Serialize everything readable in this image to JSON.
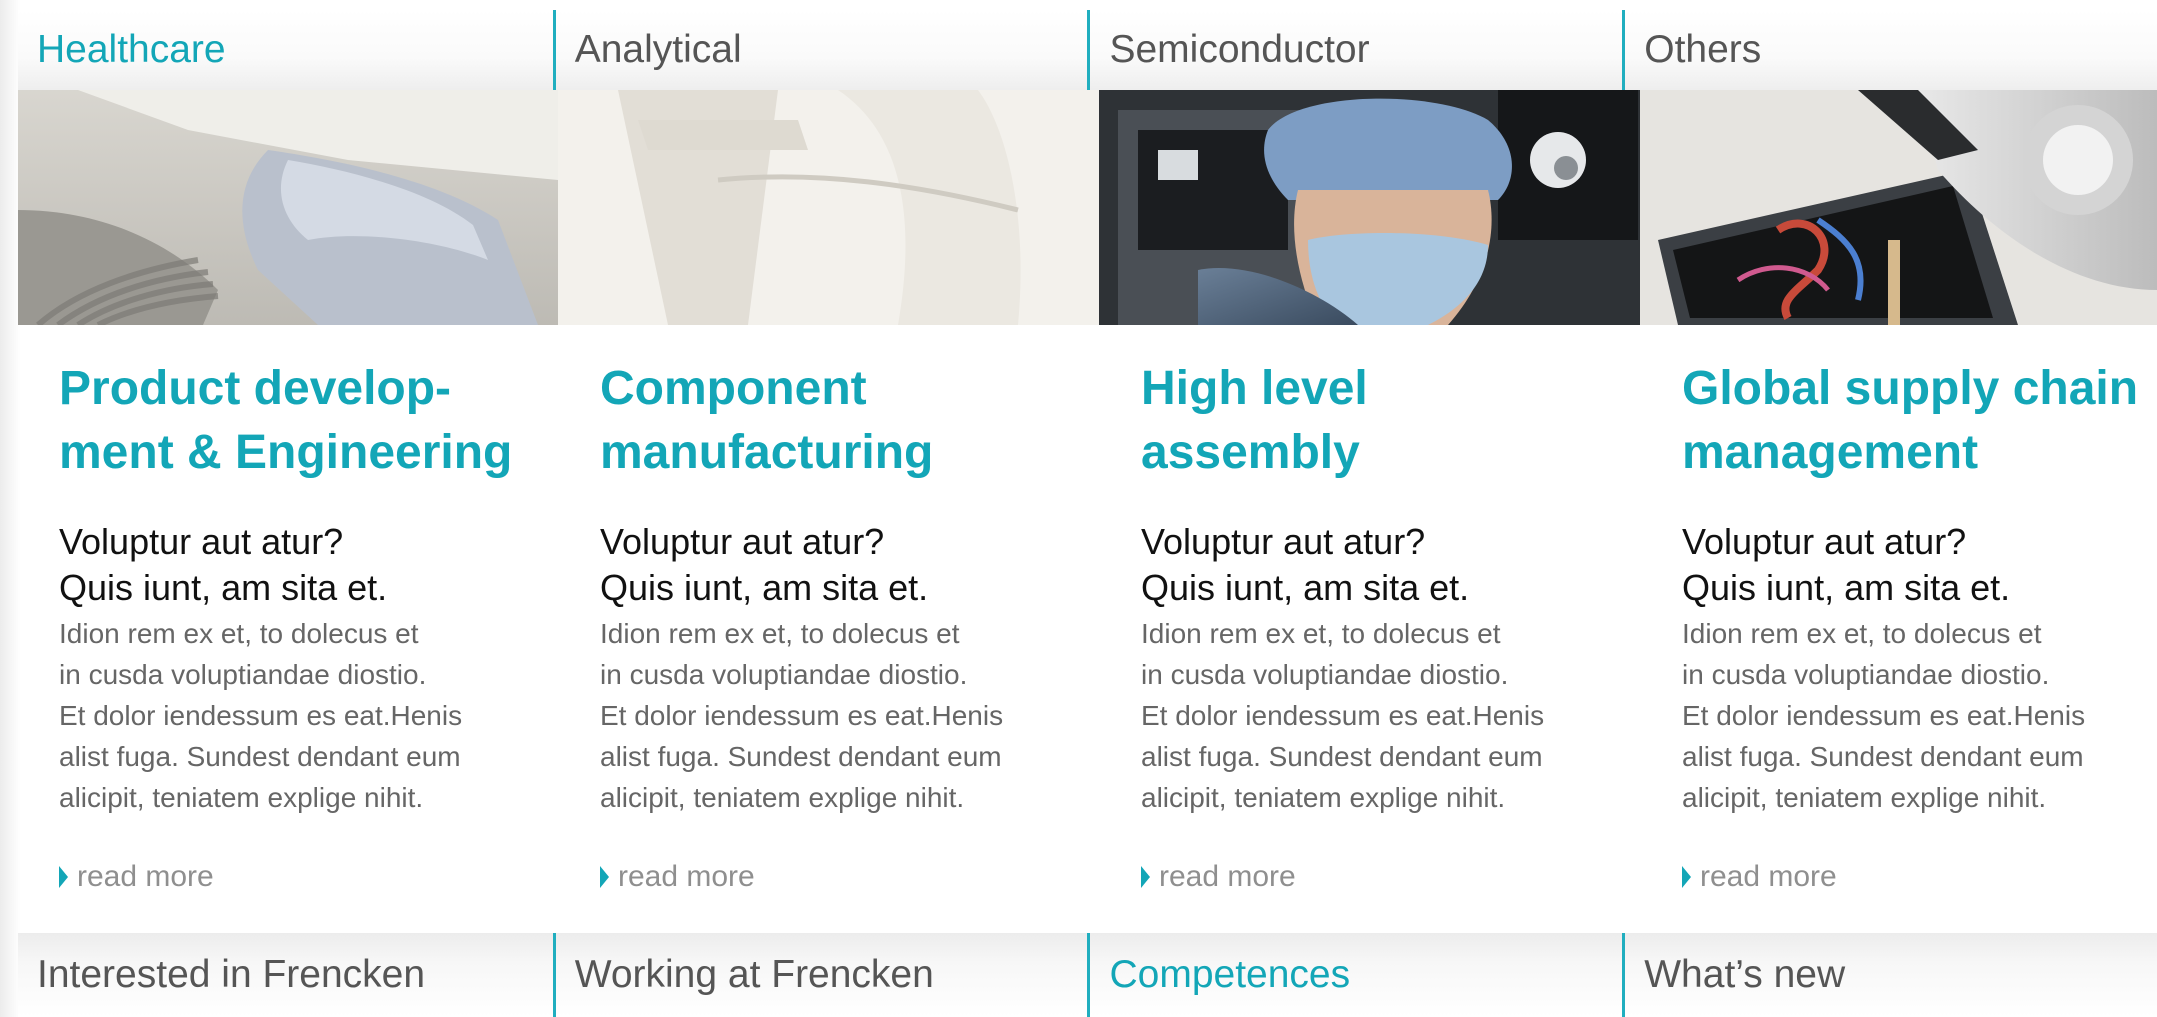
{
  "top_tabs": [
    {
      "label": "Healthcare"
    },
    {
      "label": "Analytical"
    },
    {
      "label": "Semiconductor"
    },
    {
      "label": "Others"
    }
  ],
  "columns": [
    {
      "title_line1": "Product develop-",
      "title_line2": "ment & Engineering",
      "subtitle_line1": "Voluptur aut atur?",
      "subtitle_line2": "Quis iunt, am sita et.",
      "body": [
        "Idion rem ex et, to dolecus et",
        "in cusda voluptiandae diostio.",
        "Et dolor iendessum es eat.Henis",
        "alist fuga. Sundest dendant eum",
        "alicipit, teniatem explige nihit."
      ],
      "read_more": "read more"
    },
    {
      "title_line1": "Component",
      "title_line2": "manufacturing",
      "subtitle_line1": "Voluptur aut atur?",
      "subtitle_line2": "Quis iunt, am sita et.",
      "body": [
        "Idion rem ex et, to dolecus et",
        "in cusda voluptiandae diostio.",
        "Et dolor iendessum es eat.Henis",
        "alist fuga. Sundest dendant eum",
        "alicipit, teniatem explige nihit."
      ],
      "read_more": "read more"
    },
    {
      "title_line1": "High level",
      "title_line2": "assembly",
      "subtitle_line1": "Voluptur aut atur?",
      "subtitle_line2": "Quis iunt, am sita et.",
      "body": [
        "Idion rem ex et, to dolecus et",
        "in cusda voluptiandae diostio.",
        "Et dolor iendessum es eat.Henis",
        "alist fuga. Sundest dendant eum",
        "alicipit, teniatem explige nihit."
      ],
      "read_more": "read more"
    },
    {
      "title_line1": "Global supply chain",
      "title_line2": "management",
      "subtitle_line1": "Voluptur aut atur?",
      "subtitle_line2": "Quis iunt, am sita et.",
      "body": [
        "Idion rem ex et, to dolecus et",
        "in cusda voluptiandae diostio.",
        "Et dolor iendessum es eat.Henis",
        "alist fuga. Sundest dendant eum",
        "alicipit, teniatem explige nihit."
      ],
      "read_more": "read more"
    }
  ],
  "bottom_tabs": [
    {
      "label": "Interested in Frencken"
    },
    {
      "label": "Working at Frencken"
    },
    {
      "label": "Competences"
    },
    {
      "label": "What’s new"
    }
  ],
  "colors": {
    "accent": "#13a6b7",
    "divider": "#20aebf",
    "tab_text": "#555555",
    "body_text": "#666666",
    "subtitle_text": "#111111",
    "read_more_text": "#8f8f8f"
  },
  "icons": {
    "read_more": "triangle-right-icon"
  },
  "active": {
    "top_tab": "Healthcare",
    "bottom_tab": "Competences"
  }
}
